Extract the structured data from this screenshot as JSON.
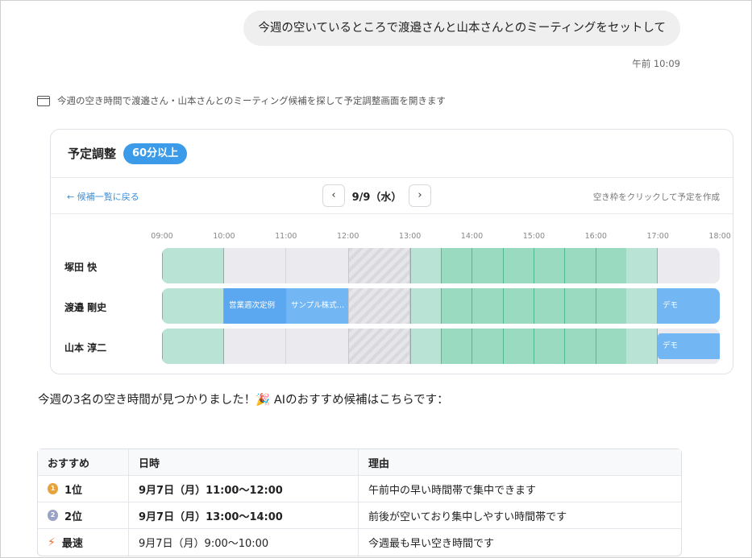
{
  "chat": {
    "user_message": "今週の空いているところで渡邉さんと山本さんとのミーティングをセットして",
    "timestamp": "午前 10:09",
    "agent_action": "今週の空き時間で渡邉さん・山本さんとのミーティング候補を探して予定調整画面を開きます",
    "summary": "今週の3名の空き時間が見つかりました！🎉 AIのおすすめ候補はこちらです："
  },
  "scheduler": {
    "title": "予定調整",
    "duration_badge": "60分以上",
    "back_link": "← 候補一覧に戻る",
    "prev_icon": "‹",
    "next_icon": "›",
    "date": "9/9（水）",
    "hint": "空き枠をクリックして予定を作成",
    "ticks": [
      "09:00",
      "10:00",
      "11:00",
      "12:00",
      "13:00",
      "14:00",
      "15:00",
      "16:00",
      "17:00",
      "18:00"
    ],
    "people": [
      {
        "name": "塚田 快",
        "events": []
      },
      {
        "name": "渡邉 剛史",
        "events": [
          "営業週次定例",
          "サンプル株式…",
          "デモ"
        ]
      },
      {
        "name": "山本 淳二",
        "events": [
          "デモ"
        ]
      }
    ],
    "colors": {
      "free": "#b9e3d4",
      "best": "#9adac1",
      "busy": "#5ba8f0",
      "accent": "#3b9be8"
    }
  },
  "recommendations": {
    "headers": [
      "おすすめ",
      "日時",
      "理由"
    ],
    "rows": [
      {
        "icon": "gold-medal-icon",
        "rank": "1位",
        "datetime": "9月7日（月）11:00〜12:00",
        "reason": "午前中の早い時間帯で集中できます"
      },
      {
        "icon": "silver-medal-icon",
        "rank": "2位",
        "datetime": "9月7日（月）13:00〜14:00",
        "reason": "前後が空いており集中しやすい時間帯です"
      },
      {
        "icon": "lightning-icon",
        "rank": "最速",
        "datetime": "9月7日（月）9:00〜10:00",
        "reason": "今週最も早い空き時間です"
      }
    ]
  }
}
